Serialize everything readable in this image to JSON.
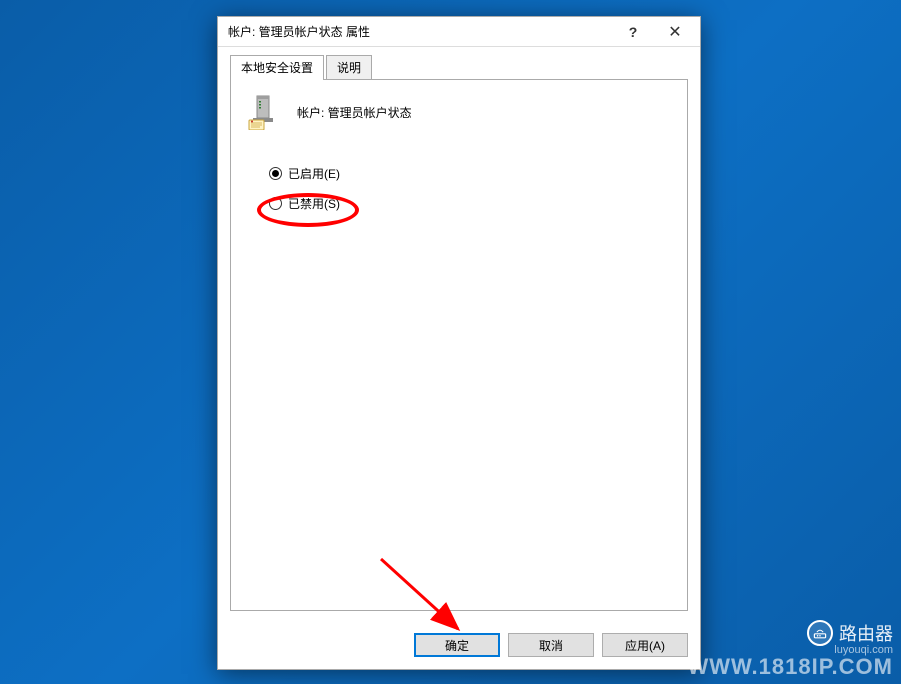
{
  "titlebar": {
    "title": "帐户: 管理员帐户状态 属性",
    "help_label": "?",
    "close_label": "✕"
  },
  "tabs": {
    "tab1": "本地安全设置",
    "tab2": "说明"
  },
  "policy": {
    "title": "帐户: 管理员帐户状态"
  },
  "radios": {
    "enabled": {
      "label": "已启用(E)",
      "checked": true
    },
    "disabled": {
      "label": "已禁用(S)",
      "checked": false
    }
  },
  "buttons": {
    "ok": "确定",
    "cancel": "取消",
    "apply": "应用(A)"
  },
  "watermark": {
    "brand": "路由器",
    "sub": "luyouqi.com",
    "big": "WWW.1818IP.COM"
  }
}
